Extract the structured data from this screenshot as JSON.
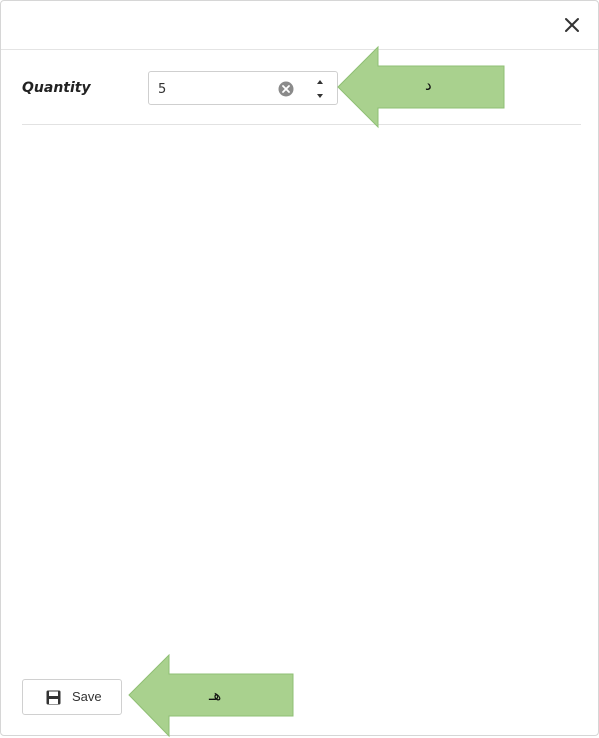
{
  "dialog": {
    "close_icon": "close-icon"
  },
  "form": {
    "quantity_label": "Quantity",
    "quantity_value": "5",
    "clear_icon": "clear-circle-icon",
    "increment_icon": "caret-up-icon",
    "decrement_icon": "caret-down-icon"
  },
  "annotations": {
    "arrow_top_text": "د",
    "arrow_bottom_text": "هـ",
    "arrow_color": "#a9d18e",
    "arrow_border_color": "#8fbf74"
  },
  "footer": {
    "save_label": "Save",
    "save_icon": "save-floppy-icon"
  }
}
